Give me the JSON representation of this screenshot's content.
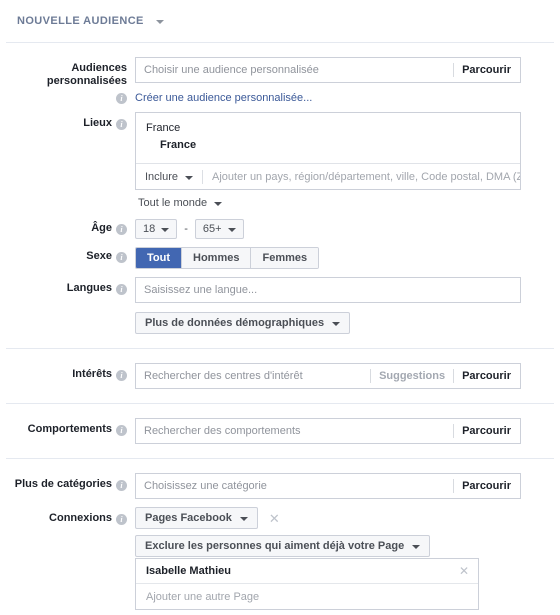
{
  "header": {
    "title": "NOUVELLE AUDIENCE",
    "caret_icon": "chevron-down-icon"
  },
  "custom_audiences": {
    "label": "Audiences personnalisées",
    "info_icon": "info-icon",
    "placeholder": "Choisir une audience personnalisée",
    "browse_label": "Parcourir",
    "create_link": "Créer une audience personnalisée..."
  },
  "locations": {
    "label": "Lieux",
    "info_icon": "info-icon",
    "group_label": "France",
    "selected_items": [
      "France"
    ],
    "include_mode": "Inclure",
    "placeholder": "Ajouter un pays, région/département, ville, Code postal, DMA (Zone ",
    "audience_scope": "Tout le monde"
  },
  "age": {
    "label": "Âge",
    "info_icon": "info-icon",
    "min": "18",
    "max": "65+",
    "separator": "-"
  },
  "gender": {
    "label": "Sexe",
    "info_icon": "info-icon",
    "options": [
      "Tout",
      "Hommes",
      "Femmes"
    ],
    "selected": "Tout"
  },
  "languages": {
    "label": "Langues",
    "info_icon": "info-icon",
    "placeholder": "Saisissez une langue..."
  },
  "more_demographics": {
    "label": "Plus de données démographiques",
    "caret_icon": "chevron-down-icon"
  },
  "interests": {
    "label": "Intérêts",
    "info_icon": "info-icon",
    "placeholder": "Rechercher des centres d'intérêt",
    "suggestions_label": "Suggestions",
    "browse_label": "Parcourir"
  },
  "behaviors": {
    "label": "Comportements",
    "info_icon": "info-icon",
    "placeholder": "Rechercher des comportements",
    "browse_label": "Parcourir"
  },
  "more_categories": {
    "label": "Plus de catégories",
    "info_icon": "info-icon",
    "placeholder": "Choisissez une catégorie",
    "browse_label": "Parcourir"
  },
  "connections": {
    "label": "Connexions",
    "info_icon": "info-icon",
    "type_label": "Pages Facebook",
    "remove_icon": "close-icon",
    "exclusion_label": "Exclure les personnes qui aiment déjà votre Page",
    "pages": [
      {
        "name": "Isabelle Mathieu",
        "remove_icon": "close-icon"
      }
    ],
    "add_page_placeholder": "Ajouter une autre Page"
  },
  "colors": {
    "accent": "#4267b2",
    "link": "#3b5998",
    "border": "#ccd0d9",
    "placeholder": "#90949c",
    "label": "#1d2129",
    "header": "#6d7b96"
  }
}
